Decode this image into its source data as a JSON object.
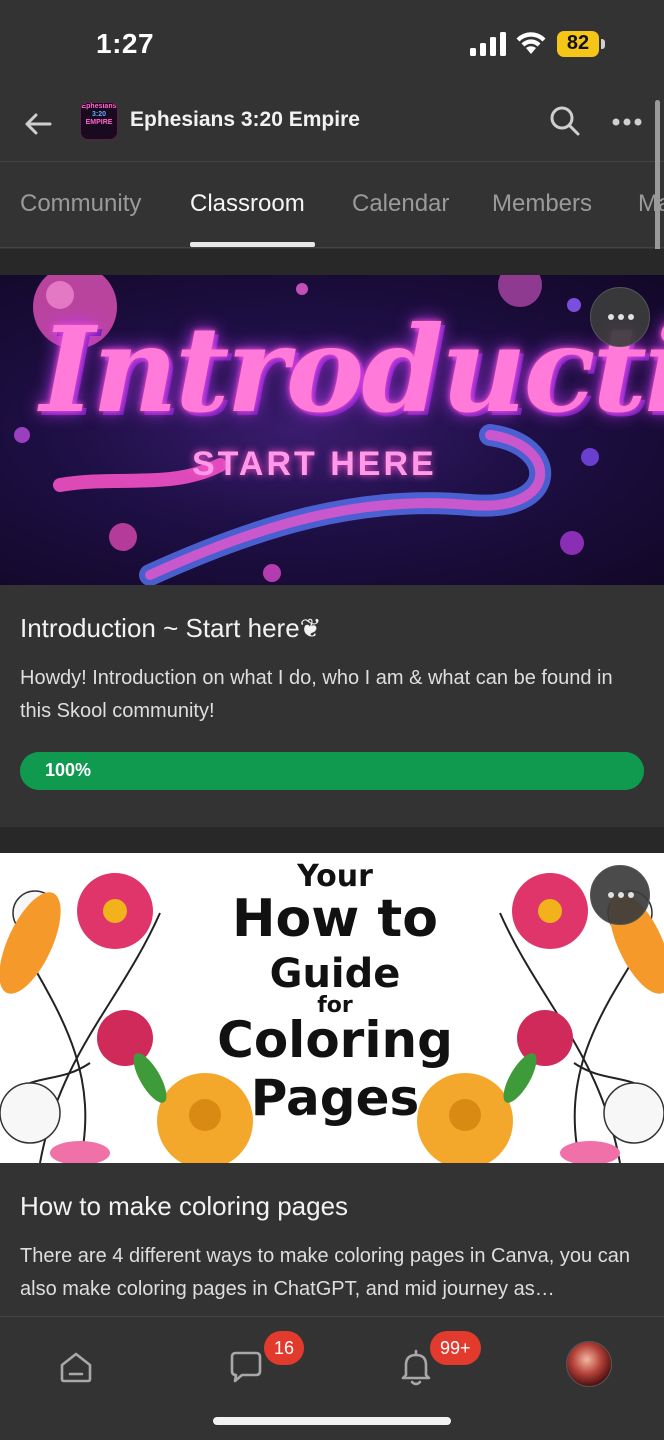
{
  "status_bar": {
    "time": "1:27",
    "battery": "82",
    "battery_color": "#f5c518"
  },
  "header": {
    "group_name": "Ephesians 3:20 Empire",
    "logo_lines": [
      "Ephesians",
      "3:20",
      "EMPIRE"
    ],
    "icons": {
      "back": "arrow-left-icon",
      "search": "search-icon",
      "more": "more-horizontal-icon"
    }
  },
  "tabs": [
    {
      "label": "Community",
      "active": false
    },
    {
      "label": "Classroom",
      "active": true
    },
    {
      "label": "Calendar",
      "active": false
    },
    {
      "label": "Members",
      "active": false
    },
    {
      "label": "Ma",
      "active": false
    }
  ],
  "courses": [
    {
      "image_text": {
        "main": "Introduction",
        "sub": "START HERE"
      },
      "title": "Introduction ~ Start here❦",
      "description": "Howdy! Introduction on what I do, who I am & what can be found in this Skool community!",
      "progress_label": "100%",
      "progress": 1.0,
      "progress_color": "#0f9a50"
    },
    {
      "image_text": {
        "line1": "Your",
        "line2": "How to",
        "line3": "Guide",
        "line4": "for",
        "line5": "Coloring",
        "line6": "Pages"
      },
      "title": "How to make coloring pages",
      "description": "There are 4 different ways to make coloring pages in Canva, you can also make coloring pages in ChatGPT, and mid journey as…"
    }
  ],
  "bottom_nav": {
    "items": [
      {
        "icon": "home-icon"
      },
      {
        "icon": "chat-icon",
        "badge": "16"
      },
      {
        "icon": "bell-icon",
        "badge": "99+"
      },
      {
        "icon": "avatar"
      }
    ],
    "badge_color": "#e23b2e"
  }
}
